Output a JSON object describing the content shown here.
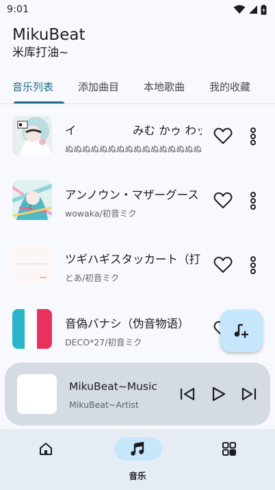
{
  "status_bar": {
    "time": "9:01",
    "icons": [
      "wifi-icon",
      "signal-icon",
      "battery-icon"
    ]
  },
  "app": {
    "title": "MikuBeat",
    "subtitle": "米库打油~"
  },
  "tabs": [
    {
      "label": "音乐列表",
      "active": true
    },
    {
      "label": "添加曲目",
      "active": false
    },
    {
      "label": "本地歌曲",
      "active": false
    },
    {
      "label": "我的收藏",
      "active": false
    }
  ],
  "songs": [
    {
      "title": "イ　　　　　みむ かゥ わッ",
      "artist": "ぬぬぬぬぬぬぬぬぬぬぬぬぬぬぬぬぬぬぬぬ"
    },
    {
      "title": "アンノウン・マザーグース",
      "artist": "wowaka/初音ミク"
    },
    {
      "title": "ツギハギスタッカート（打",
      "artist": "とあ/初音ミク"
    },
    {
      "title": "音偽バナシ（伪音物语）",
      "artist": "DECO*27/初音ミク"
    }
  ],
  "fab": {
    "icon": "music-note-add-icon"
  },
  "player": {
    "title": "MikuBeat~Music",
    "artist": "MikuBeat~Artist",
    "controls": [
      "skip-previous-icon",
      "play-icon",
      "skip-next-icon"
    ]
  },
  "bottom_nav": [
    {
      "label": "",
      "icon": "home-icon",
      "active": false
    },
    {
      "label": "音乐",
      "icon": "music-note-icon",
      "active": true
    },
    {
      "label": "",
      "icon": "grid-icon",
      "active": false
    }
  ],
  "colors": {
    "accent": "#1f6a8c",
    "background": "#f8f9fe",
    "player_bg": "#d5dbe2",
    "nav_bg": "#e6ecf3",
    "highlight": "#c6e7fb"
  }
}
